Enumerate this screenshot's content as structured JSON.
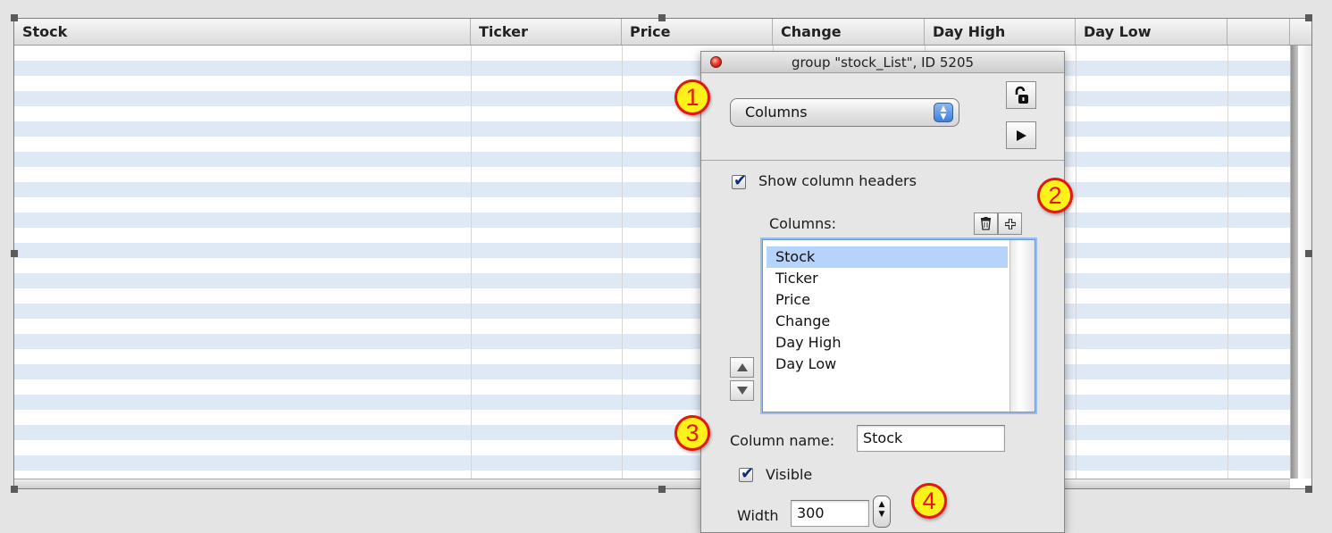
{
  "table": {
    "columns": [
      "Stock",
      "Ticker",
      "Price",
      "Change",
      "Day High",
      "Day Low"
    ]
  },
  "palette": {
    "title": "group \"stock_List\", ID 5205",
    "section_popup": "Columns",
    "show_headers_label": "Show column headers",
    "show_headers_checked": true,
    "columns_label": "Columns:",
    "column_list": [
      "Stock",
      "Ticker",
      "Price",
      "Change",
      "Day High",
      "Day Low"
    ],
    "selected_column": "Stock",
    "column_name_label": "Column name:",
    "column_name_value": "Stock",
    "visible_label": "Visible",
    "visible_checked": true,
    "width_label": "Width",
    "width_value": "300"
  },
  "callouts": [
    "1",
    "2",
    "3",
    "4"
  ],
  "icons": {
    "close": "close-icon",
    "lock": "unlock-icon",
    "play": "play-icon",
    "trash": "trash-icon",
    "add": "add-icon",
    "up": "arrow-up-icon",
    "down": "arrow-down-icon"
  },
  "colors": {
    "row_stripe": "#dfe8f5",
    "selection": "#b5d3fb",
    "callout_fill": "#fff21a",
    "callout_border": "#e3170d"
  }
}
